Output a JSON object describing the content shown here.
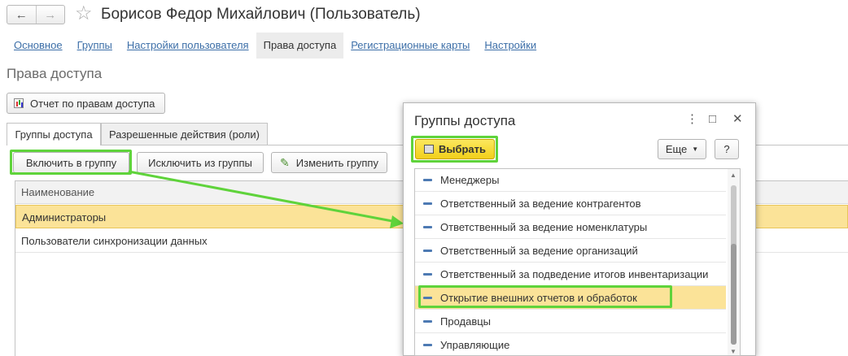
{
  "window": {
    "title": "Борисов Федор Михайлович (Пользователь)",
    "back_icon": "arrow-left-icon",
    "forward_icon": "arrow-right-icon",
    "favorite_icon": "star-icon"
  },
  "top_links": [
    {
      "label": "Основное",
      "active": false
    },
    {
      "label": "Группы",
      "active": false
    },
    {
      "label": "Настройки пользователя",
      "active": false
    },
    {
      "label": "Права доступа",
      "active": true
    },
    {
      "label": "Регистрационные карты",
      "active": false
    },
    {
      "label": "Настройки",
      "active": false
    }
  ],
  "page": {
    "heading": "Права доступа",
    "report_button": "Отчет по правам доступа"
  },
  "tabs": [
    {
      "label": "Группы доступа",
      "active": true
    },
    {
      "label": "Разрешенные действия (роли)",
      "active": false
    }
  ],
  "toolbar": {
    "include": "Включить в группу",
    "exclude": "Исключить из группы",
    "edit": "Изменить группу"
  },
  "table": {
    "column": "Наименование",
    "rows": [
      {
        "name": "Администраторы",
        "selected": true
      },
      {
        "name": "Пользователи синхронизации данных",
        "selected": false
      }
    ]
  },
  "dialog": {
    "title": "Группы доступа",
    "choose_button": "Выбрать",
    "more_button": "Еще",
    "help_button": "?",
    "menu_icon": "kebab-icon",
    "maximize_icon": "square-icon",
    "close_icon": "close-icon",
    "items": [
      {
        "label": "Менеджеры",
        "selected": false
      },
      {
        "label": "Ответственный за ведение контрагентов",
        "selected": false
      },
      {
        "label": "Ответственный за ведение номенклатуры",
        "selected": false
      },
      {
        "label": "Ответственный за ведение организаций",
        "selected": false
      },
      {
        "label": "Ответственный за подведение итогов инвентаризации",
        "selected": false
      },
      {
        "label": "Открытие внешних отчетов и обработок",
        "selected": true
      },
      {
        "label": "Продавцы",
        "selected": false
      },
      {
        "label": "Управляющие",
        "selected": false
      }
    ]
  },
  "colors": {
    "highlight": "#5fd33b",
    "selection": "#fbe398",
    "link": "#3d6fa8",
    "accent_button": "#f2cf1a"
  }
}
